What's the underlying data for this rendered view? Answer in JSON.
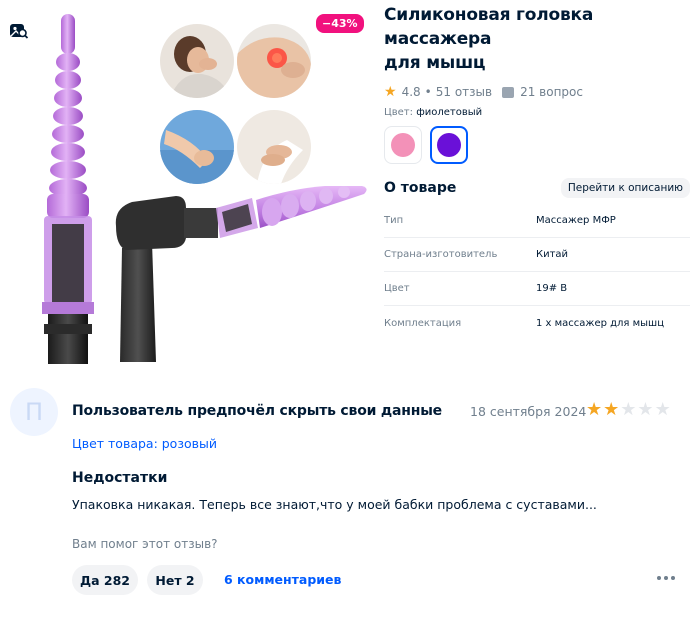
{
  "product": {
    "discount": "−43%",
    "title_line1": "Силиконовая головка массажера",
    "title_line2": "для мышц",
    "rating": "4.8",
    "reviews": "51 отзыв",
    "questions": "21 вопрос",
    "color_label": "Цвет:",
    "color_value": "фиолетовый",
    "swatches": [
      {
        "color": "#f391b8"
      },
      {
        "color": "#6a10d8"
      }
    ]
  },
  "about": {
    "title": "О товаре",
    "link": "Перейти к описанию",
    "specs": [
      {
        "key": "Тип",
        "value": "Массажер МФР"
      },
      {
        "key": "Страна-изготовитель",
        "value": "Китай"
      },
      {
        "key": "Цвет",
        "value": "19# B"
      },
      {
        "key": "Комплектация",
        "value": "1 x массажер для мышц"
      }
    ]
  },
  "review": {
    "avatar_letter": "П",
    "author": "Пользователь предпочёл скрыть свои данные",
    "date": "18 сентября 2024",
    "stars": 2,
    "variant": "Цвет товара: розовый",
    "cons_title": "Недостатки",
    "cons_text": "Упаковка никакая. Теперь все знают,что у моей бабки проблема с суставами...",
    "helpful_question": "Вам помог этот отзыв?",
    "yes": "Да 282",
    "no": "Нет 2",
    "comments": "6 комментариев"
  },
  "colors": {
    "accent": "#005bff",
    "discount": "#f1117e",
    "star": "#f5a623"
  }
}
